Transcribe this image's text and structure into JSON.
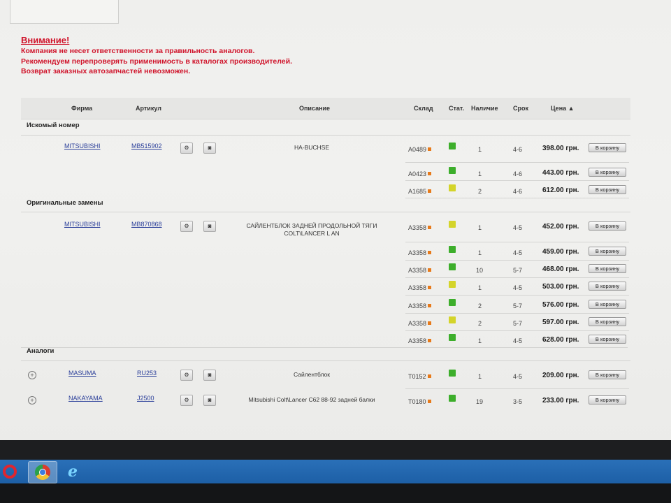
{
  "warning": {
    "title": "Внимание!",
    "lines": [
      "Компания не несет ответственности за правильность аналогов.",
      "Рекомендуем перепроверять применимость в каталогах производителей.",
      "Возврат заказных автозапчастей невозможен."
    ]
  },
  "columns": {
    "firm": "Фирма",
    "article": "Артикул",
    "description": "Описание",
    "warehouse": "Склад",
    "status": "Стат.",
    "availability": "Наличие",
    "term": "Срок",
    "price": "Цена ▲"
  },
  "sections": {
    "searched": "Искомый номер",
    "original": "Оригинальные замены",
    "analogs": "Аналоги"
  },
  "cart_label": "В корзину",
  "status_colors": {
    "green": "#3dae2b",
    "yellow": "#d4d42a"
  },
  "groups": [
    {
      "firm": "MITSUBISHI",
      "article": "MB515902",
      "description": "HA-BUCHSE",
      "rows": [
        {
          "warehouse": "A0489",
          "status": "green",
          "qty": "1",
          "term": "4-6",
          "price": "398.00 грн."
        },
        {
          "warehouse": "A0423",
          "status": "green",
          "qty": "1",
          "term": "4-6",
          "price": "443.00 грн."
        },
        {
          "warehouse": "A1685",
          "status": "yellow",
          "qty": "2",
          "term": "4-6",
          "price": "612.00 грн."
        }
      ]
    },
    {
      "firm": "MITSUBISHI",
      "article": "MB870868",
      "description": "САЙЛЕНТБЛОК ЗАДНЕЙ ПРОДОЛЬНОЙ ТЯГИ COLT\\LANCER L AN",
      "rows": [
        {
          "warehouse": "A3358",
          "status": "yellow",
          "qty": "1",
          "term": "4-5",
          "price": "452.00 грн."
        },
        {
          "warehouse": "A3358",
          "status": "green",
          "qty": "1",
          "term": "4-5",
          "price": "459.00 грн."
        },
        {
          "warehouse": "A3358",
          "status": "green",
          "qty": "10",
          "term": "5-7",
          "price": "468.00 грн."
        },
        {
          "warehouse": "A3358",
          "status": "yellow",
          "qty": "1",
          "term": "4-5",
          "price": "503.00 грн."
        },
        {
          "warehouse": "A3358",
          "status": "green",
          "qty": "2",
          "term": "5-7",
          "price": "576.00 грн."
        },
        {
          "warehouse": "A3358",
          "status": "yellow",
          "qty": "2",
          "term": "5-7",
          "price": "597.00 грн."
        },
        {
          "warehouse": "A3358",
          "status": "green",
          "qty": "1",
          "term": "4-5",
          "price": "628.00 грн."
        }
      ]
    },
    {
      "firm": "MASUMA",
      "article": "RU253",
      "description": "Сайлентблок",
      "rows": [
        {
          "warehouse": "T0152",
          "status": "green",
          "qty": "1",
          "term": "4-5",
          "price": "209.00 грн."
        }
      ]
    },
    {
      "firm": "NAKAYAMA",
      "article": "J2500",
      "description": "Mitsubishi Colt\\Lancer C62 88-92 задней балки",
      "rows": [
        {
          "warehouse": "T0180",
          "status": "green",
          "qty": "19",
          "term": "3-5",
          "price": "233.00 грн."
        }
      ]
    }
  ],
  "taskbar": {
    "icons": [
      "opera-icon",
      "chrome-icon",
      "internet-explorer-icon"
    ]
  }
}
